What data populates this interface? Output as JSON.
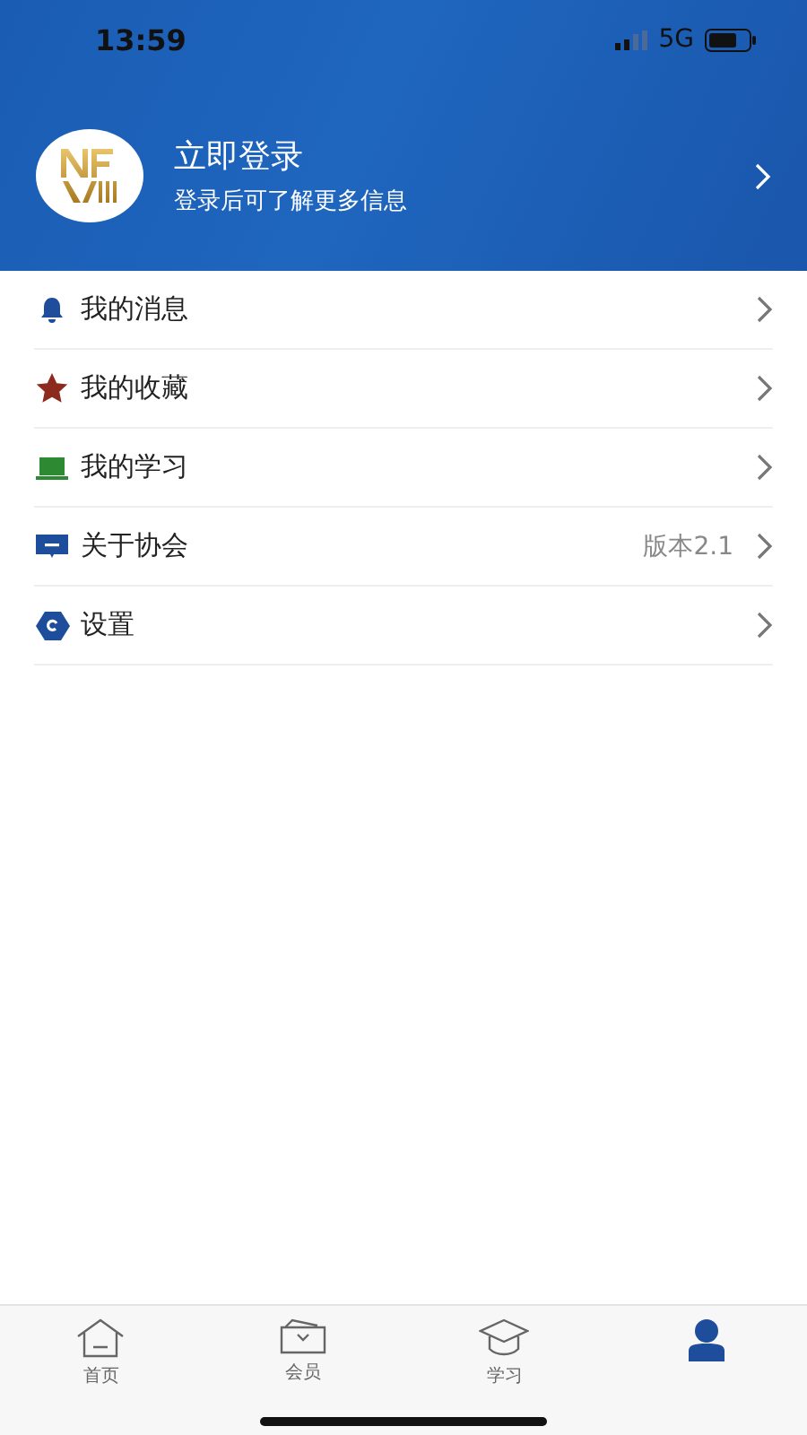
{
  "status_bar": {
    "time": "13:59",
    "network": "5G"
  },
  "profile": {
    "title": "立即登录",
    "subtitle": "登录后可了解更多信息"
  },
  "menu": [
    {
      "label": "我的消息"
    },
    {
      "label": "我的收藏"
    },
    {
      "label": "我的学习"
    },
    {
      "label": "关于协会",
      "value": "版本2.1"
    },
    {
      "label": "设置"
    }
  ],
  "tab_bar": [
    {
      "label": "首页",
      "selected": false
    },
    {
      "label": "会员",
      "selected": false
    },
    {
      "label": "学习",
      "selected": false
    },
    {
      "selected": true
    }
  ]
}
